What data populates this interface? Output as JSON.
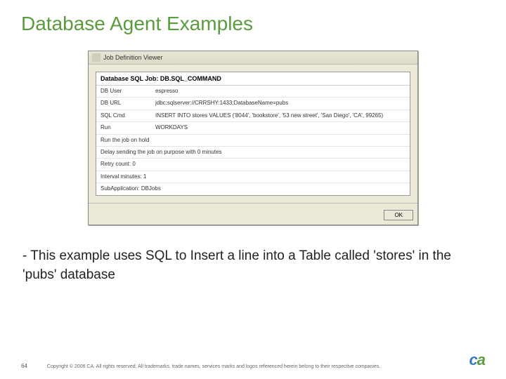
{
  "title": "Database Agent Examples",
  "window": {
    "titlebar": "Job Definition Viewer",
    "header": "Database SQL Job: DB.SQL_COMMAND",
    "rows": [
      {
        "label": "DB User",
        "value": "espresso"
      },
      {
        "label": "DB URL",
        "value": "jdbc:sqlserver://CRRSHY:1433;DatabaseName=pubs"
      },
      {
        "label": "SQL Cmd",
        "value": "INSERT INTO stores VALUES ('8044', 'bookstore', '53 new street', 'San Diego', 'CA', 99265)"
      },
      {
        "label": "Run",
        "value": "WORKDAYS"
      },
      {
        "full": "Run the job on hold"
      },
      {
        "full": "Delay sending the job on purpose with 0 minutes"
      },
      {
        "full": "Retry count: 0"
      },
      {
        "full": "Interval minutes: 1"
      },
      {
        "full": "SubApplication: DBJobs"
      }
    ],
    "ok": "OK"
  },
  "bullet": {
    "dash": "- ",
    "text": "This example uses SQL to Insert a line into a Table called 'stores' in the 'pubs' database"
  },
  "footer": {
    "page": "64",
    "copyright": "Copyright © 2006 CA. All rights reserved. All trademarks, trade names, services marks and logos referenced herein belong to their respective companies.",
    "logo_c": "c",
    "logo_a": "a"
  }
}
